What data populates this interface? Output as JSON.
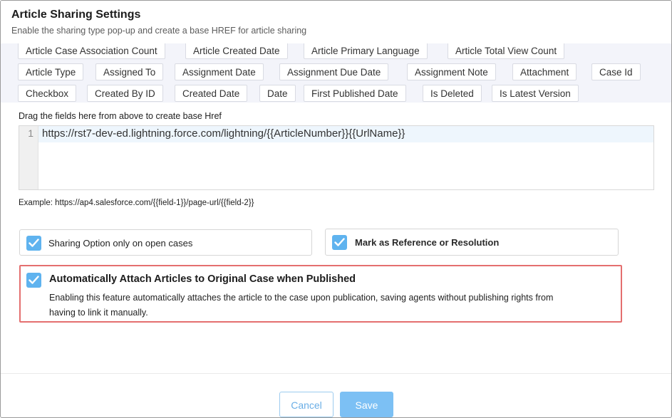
{
  "dialog": {
    "title": "Article Sharing Settings",
    "subtitle": "Enable the sharing type pop-up and create a base HREF for article sharing"
  },
  "fields": {
    "row1": [
      "Article Case Association Count",
      "Article Created Date",
      "Article Primary Language",
      "Article Total View Count"
    ],
    "row2": [
      "Article Type",
      "Assigned To",
      "Assignment Date",
      "Assignment Due Date",
      "Assignment Note",
      "Attachment",
      "Case Id"
    ],
    "row3": [
      "Checkbox",
      "Created By ID",
      "Created Date",
      "Date",
      "First Published Date",
      "Is Deleted",
      "Is Latest Version"
    ]
  },
  "href_editor": {
    "label": "Drag the fields here from above to create base Href",
    "line_number": "1",
    "value": "https://rst7-dev-ed.lightning.force.com/lightning/{{ArticleNumber}}{{UrlName}}"
  },
  "example_text": "Example: https://ap4.salesforce.com/{{field-1}}/page-url/{{field-2}}",
  "options": {
    "open_cases": {
      "label": "Sharing Option only on open cases",
      "checked": true
    },
    "reference": {
      "label": "Mark as Reference or Resolution",
      "checked": true
    },
    "auto_attach": {
      "title": "Automatically Attach Articles to Original Case when Published",
      "description": "Enabling this feature automatically attaches the article to the case upon publication, saving agents without publishing rights from having to link it manually.",
      "checked": true
    }
  },
  "footer": {
    "cancel_label": "Cancel",
    "save_label": "Save"
  },
  "colors": {
    "accent": "#5fb3ef",
    "save": "#7cc0f4",
    "highlight_border": "#e46f6f",
    "chips_bg": "#f3f4fa"
  },
  "icons": {
    "checkbox": "check-icon"
  }
}
